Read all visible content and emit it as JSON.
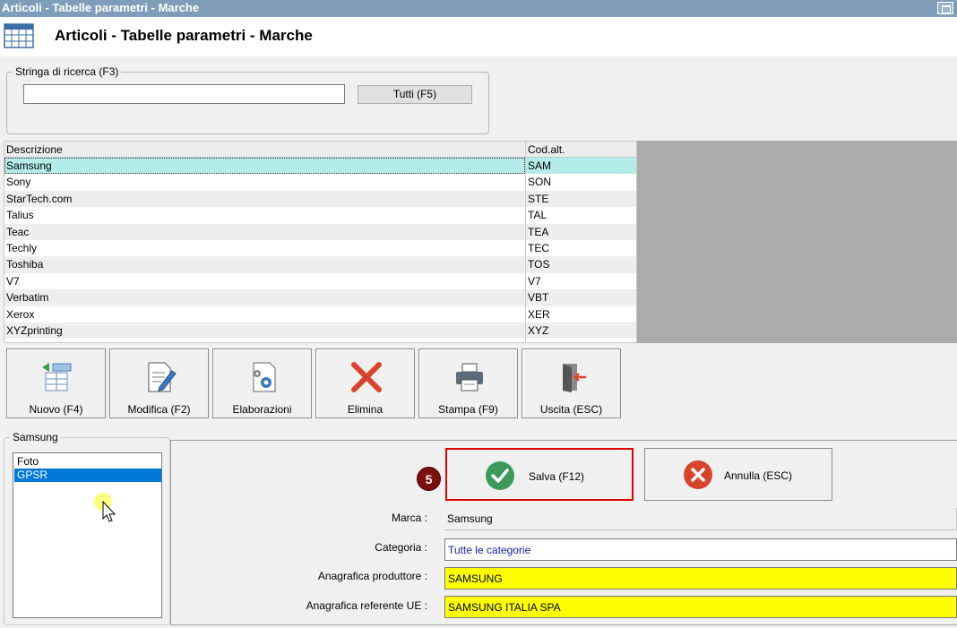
{
  "window": {
    "title": "Articoli - Tabelle parametri - Marche"
  },
  "header": {
    "title": "Articoli - Tabelle parametri - Marche",
    "icon": "table-grid-icon"
  },
  "search": {
    "legend": "Stringa di ricerca (F3)",
    "value": "",
    "tutti_label": "Tutti (F5)"
  },
  "grid": {
    "columns": [
      "Descrizione",
      "Cod.alt."
    ],
    "rows": [
      [
        "Samsung",
        "SAM"
      ],
      [
        "Sony",
        "SON"
      ],
      [
        "StarTech.com",
        "STE"
      ],
      [
        "Talius",
        "TAL"
      ],
      [
        "Teac",
        "TEA"
      ],
      [
        "Techly",
        "TEC"
      ],
      [
        "Toshiba",
        "TOS"
      ],
      [
        "V7",
        "V7"
      ],
      [
        "Verbatim",
        "VBT"
      ],
      [
        "Xerox",
        "XER"
      ],
      [
        "XYZprinting",
        "XYZ"
      ]
    ],
    "selected_index": 0
  },
  "toolbar": {
    "buttons": [
      {
        "label": "Nuovo (F4)",
        "icon": "new-record-icon"
      },
      {
        "label": "Modifica (F2)",
        "icon": "edit-document-icon"
      },
      {
        "label": "Elaborazioni",
        "icon": "process-gear-icon"
      },
      {
        "label": "Elimina",
        "icon": "delete-x-icon"
      },
      {
        "label": "Stampa (F9)",
        "icon": "printer-icon"
      },
      {
        "label": "Uscita (ESC)",
        "icon": "exit-door-icon"
      }
    ]
  },
  "detail": {
    "legend": "Samsung",
    "list_items": [
      "Foto",
      "GPSR"
    ],
    "selected_item": "GPSR",
    "step_number": "5",
    "save_label": "Salva (F12)",
    "cancel_label": "Annulla (ESC)",
    "fields": {
      "marca": {
        "label": "Marca :",
        "value": "Samsung"
      },
      "categoria": {
        "label": "Categoria :",
        "value": "Tutte le categorie"
      },
      "produttore": {
        "label": "Anagrafica produttore :",
        "value": "SAMSUNG"
      },
      "referente": {
        "label": "Anagrafica referente UE :",
        "value": "SAMSUNG ITALIA SPA"
      }
    }
  },
  "colors": {
    "accent_yellow": "#ffff00",
    "selection_row": "#b3ece9",
    "highlight_red": "#e00000",
    "list_selection": "#0078d7"
  }
}
